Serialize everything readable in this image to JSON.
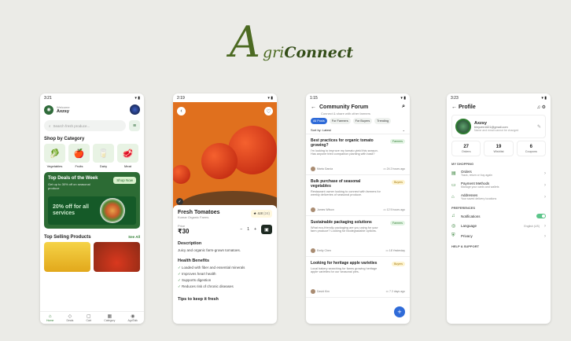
{
  "logo": {
    "big": "A",
    "green": "gri",
    "rest": "Connect"
  },
  "home": {
    "time": "3:21",
    "welcome": "Welcome",
    "user": "Axzsy",
    "search_placeholder": "Search fresh produce...",
    "category_title": "Shop by Category",
    "categories": [
      {
        "label": "Vegetables",
        "icon": "vegetables-icon",
        "glyph": "🥬"
      },
      {
        "label": "Fruits",
        "icon": "fruits-icon",
        "glyph": "🍎"
      },
      {
        "label": "Dairy",
        "icon": "dairy-icon",
        "glyph": "🥛"
      },
      {
        "label": "Meat",
        "icon": "meat-icon",
        "glyph": "🥩"
      }
    ],
    "deals_title": "Top Deals of the Week",
    "deals_sub": "Get up to 30% off on seasonal produce",
    "shop_now": "Shop Now",
    "promo": "20% off for all services",
    "selling_title": "Top Selling Products",
    "see_all": "See All",
    "nav": [
      {
        "label": "Home",
        "glyph": "⌂"
      },
      {
        "label": "Deals",
        "glyph": "◇"
      },
      {
        "label": "Cart",
        "glyph": "▢"
      },
      {
        "label": "Category",
        "glyph": "▦"
      },
      {
        "label": "AgriTalk",
        "glyph": "◉"
      }
    ]
  },
  "product": {
    "time": "2:19",
    "name": "Fresh Tomatoes",
    "farm": "Kumar Organic Farms",
    "rating": "4.8",
    "reviews": "(24)",
    "price_label": "Price",
    "price": "₹30",
    "qty": "1",
    "desc_title": "Description",
    "desc": "Juicy and organic farm-grown tomatoes.",
    "benefits_title": "Health Benefits",
    "benefits": [
      "Loaded with fiber and essential minerals",
      "Improves heart health",
      "Supports digestion",
      "Reduces risk of chronic diseases"
    ],
    "tips_title": "Tips to keep it fresh"
  },
  "forum": {
    "time": "1:15",
    "title": "Community Forum",
    "subtitle": "Connect & share with other farmers",
    "chips": [
      "All Posts",
      "For Farmers",
      "For Buyers",
      "Trending"
    ],
    "sort": "Sort by: Latest",
    "posts": [
      {
        "title": "Best practices for organic tomato growing?",
        "desc": "I'm looking to improve my tomato yield this season. Has anyone tried companion planting with basil?",
        "tag": "Farmers",
        "author": "Maria Garcia",
        "count": "24",
        "time": "2 hours ago"
      },
      {
        "title": "Bulk purchase of seasonal vegetables",
        "desc": "Restaurant owner looking to connect with farmers for weekly deliveries of seasonal produce.",
        "tag": "Buyers",
        "author": "James Wilson",
        "count": "12",
        "time": "5 hours ago"
      },
      {
        "title": "Sustainable packaging solutions",
        "desc": "What eco-friendly packaging are you using for your farm produce? Looking for biodegradable options.",
        "tag": "Farmers",
        "author": "Emily Chen",
        "count": "18",
        "time": "Yesterday"
      },
      {
        "title": "Looking for heritage apple varieties",
        "desc": "Local bakery searching for farms growing heritage apple varieties for our seasonal pies.",
        "tag": "Buyers",
        "author": "David Kim",
        "count": "7",
        "time": "2 days ago"
      }
    ]
  },
  "profile": {
    "time": "3:23",
    "title": "Profile",
    "name": "Axzsy",
    "email": "binyzen1621@gmail.com",
    "note": "Name and email cannot be changed",
    "stats": [
      {
        "value": "27",
        "label": "Orders"
      },
      {
        "value": "19",
        "label": "Wishlist"
      },
      {
        "value": "6",
        "label": "Coupons"
      }
    ],
    "my_shopping": "MY SHOPPING",
    "shopping": [
      {
        "title": "Orders",
        "sub": "Track, return or buy again",
        "glyph": "▤"
      },
      {
        "title": "Payment Methods",
        "sub": "Manage your cards and wallets",
        "glyph": "▭"
      },
      {
        "title": "Addresses",
        "sub": "Your saved delivery locations",
        "glyph": "⌂"
      }
    ],
    "preferences": "PREFERENCES",
    "notifications": "Notifications",
    "language": "Language",
    "language_value": "English (US)",
    "privacy": "Privacy",
    "help": "HELP & SUPPORT"
  }
}
